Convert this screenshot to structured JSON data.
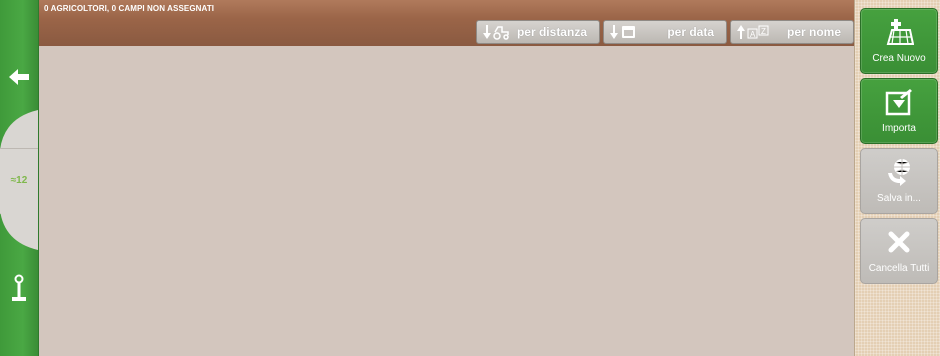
{
  "status_text": "0 AGRICOLTORI, 0 CAMPI NON ASSEGNATI",
  "sort_buttons": [
    {
      "label": "per distanza",
      "icon": "tractor-distance-icon"
    },
    {
      "label": "per data",
      "icon": "calendar-icon"
    },
    {
      "label": "per nome",
      "icon": "alphabet-sort-icon"
    }
  ],
  "left_rail": {
    "back_icon": "back-arrow-icon",
    "gps_label": "≈12",
    "joystick_icon": "joystick-icon"
  },
  "actions": [
    {
      "label": "Crea Nuovo",
      "icon": "new-field-icon",
      "enabled": true
    },
    {
      "label": "Importa",
      "icon": "import-icon",
      "enabled": true
    },
    {
      "label": "Salva in...",
      "icon": "save-globe-icon",
      "enabled": false
    },
    {
      "label": "Cancella Tutti",
      "icon": "close-icon",
      "enabled": false
    }
  ],
  "colors": {
    "green": "#46a13f",
    "brown_bar": "#9b6548",
    "background": "#d3c6be",
    "disabled": "#c7c4c0"
  }
}
